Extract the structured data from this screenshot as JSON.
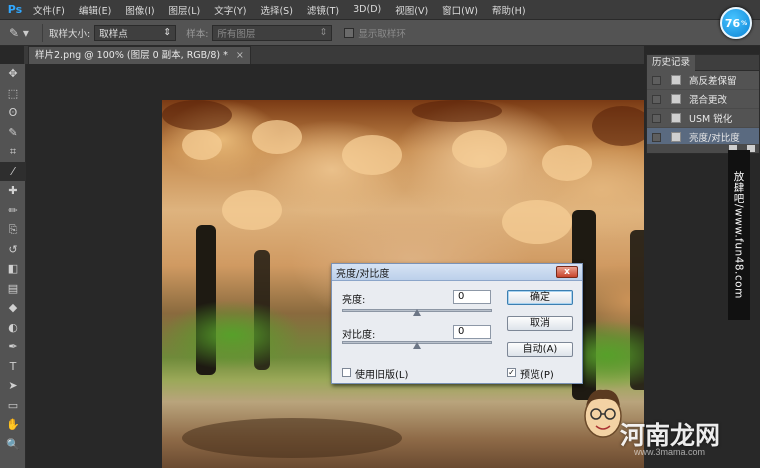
{
  "app": {
    "logo": "Ps",
    "zoom_badge": "76",
    "zoom_badge_unit": "%"
  },
  "menu": [
    "文件(F)",
    "编辑(E)",
    "图像(I)",
    "图层(L)",
    "文字(Y)",
    "选择(S)",
    "滤镜(T)",
    "3D(D)",
    "视图(V)",
    "窗口(W)",
    "帮助(H)"
  ],
  "options": {
    "tool_icon": "eyedropper-icon",
    "sample_size_label": "取样大小:",
    "sample_size_value": "取样点",
    "sample_label": "样本:",
    "sample_value": "所有图层",
    "show_ring_label": "显示取样环",
    "show_ring_checked": false
  },
  "document": {
    "tab_title": "样片2.png @ 100% (图层 0 副本, RGB/8) *",
    "close": "×"
  },
  "toolbar": [
    "move-tool",
    "marquee-tool",
    "lasso-tool",
    "quick-select-tool",
    "crop-tool",
    "eyedropper-tool",
    "healing-tool",
    "brush-tool",
    "clone-tool",
    "history-brush-tool",
    "eraser-tool",
    "gradient-tool",
    "blur-tool",
    "dodge-tool",
    "pen-tool",
    "type-tool",
    "path-select-tool",
    "shape-tool",
    "hand-tool",
    "zoom-tool"
  ],
  "toolbar_glyphs": [
    "✥",
    "⬚",
    "ʘ",
    "✎",
    "⌗",
    "⁄",
    "✚",
    "✏",
    "⎘",
    "↺",
    "◧",
    "▤",
    "◆",
    "◐",
    "✒",
    "T",
    "➤",
    "▭",
    "✋",
    "🔍"
  ],
  "history": {
    "title": "历史记录",
    "items": [
      {
        "label": "高反差保留",
        "selected": false
      },
      {
        "label": "混合更改",
        "selected": false
      },
      {
        "label": "USM 锐化",
        "selected": false
      },
      {
        "label": "亮度/对比度",
        "selected": true
      }
    ]
  },
  "dialog": {
    "title": "亮度/对比度",
    "close": "x",
    "brightness_label": "亮度:",
    "brightness_value": "0",
    "contrast_label": "对比度:",
    "contrast_value": "0",
    "ok": "确定",
    "cancel": "取消",
    "auto": "自动(A)",
    "use_legacy_label": "使用旧版(L)",
    "use_legacy_checked": false,
    "preview_label": "预览(P)",
    "preview_checked": true,
    "check_mark": "✓"
  },
  "watermarks": {
    "side_text": "放肆吧/www.fun48.com",
    "brand_text": "河南龙网",
    "brand_url": "www.3mama.com"
  },
  "colors": {
    "accent": "#31a8ff",
    "selected_row": "#5a6a80",
    "panel": "#535353"
  }
}
